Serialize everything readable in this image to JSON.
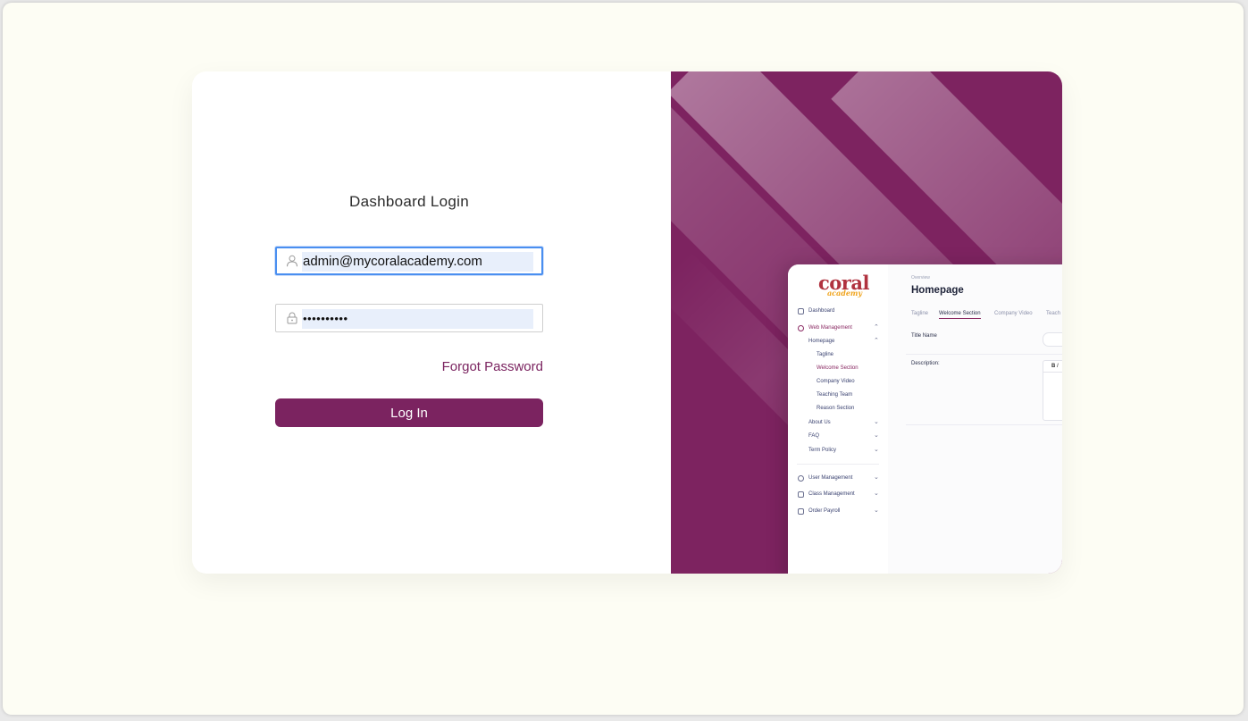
{
  "login": {
    "title": "Dashboard Login",
    "email_value": "admin@mycoralacademy.com",
    "password_masked": "••••••••••",
    "forgot_label": "Forgot Password",
    "login_button": "Log In"
  },
  "preview": {
    "logo": {
      "main": "coral",
      "sub": "academy"
    },
    "sidebar": {
      "dashboard": "Dashboard",
      "web_management": "Web Management",
      "homepage": "Homepage",
      "sub_items": [
        "Tagline",
        "Welcome Section",
        "Company Video",
        "Teaching Team",
        "Reason Section"
      ],
      "about_us": "About Us",
      "faq": "FAQ",
      "term_policy": "Term Policy",
      "user_management": "User Management",
      "class_management": "Class Management",
      "order_payroll": "Order Payroll"
    },
    "main": {
      "breadcrumb": "Overview",
      "title": "Homepage",
      "tabs": [
        "Tagline",
        "Welcome Section",
        "Company Video",
        "Teach"
      ],
      "title_name_label": "Title Name",
      "description_label": "Description:"
    }
  },
  "colors": {
    "brand": "#7b2360",
    "page_bg": "#fdfdf4",
    "focus_border": "#4a8ff0",
    "selection": "#e8effb"
  },
  "icons": {
    "email_field": "user-icon",
    "password_field": "lock-icon"
  }
}
